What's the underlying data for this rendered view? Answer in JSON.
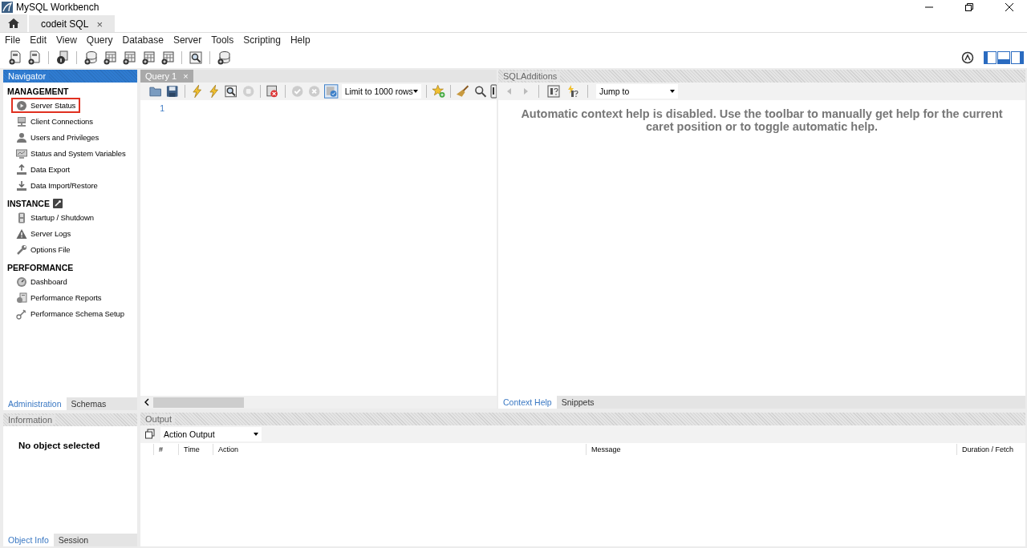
{
  "window": {
    "title": "MySQL Workbench"
  },
  "connection_tabs": [
    {
      "label": "codeit SQL",
      "close": "×",
      "selected": true
    }
  ],
  "menu": [
    "File",
    "Edit",
    "View",
    "Query",
    "Database",
    "Server",
    "Tools",
    "Scripting",
    "Help"
  ],
  "navigator": {
    "title": "Navigator",
    "sections": [
      {
        "heading": "MANAGEMENT",
        "items": [
          {
            "label": "Server Status",
            "highlighted": true
          },
          {
            "label": "Client Connections",
            "highlighted": false
          },
          {
            "label": "Users and Privileges",
            "highlighted": false
          },
          {
            "label": "Status and System Variables",
            "highlighted": false
          },
          {
            "label": "Data Export",
            "highlighted": false
          },
          {
            "label": "Data Import/Restore",
            "highlighted": false
          }
        ]
      },
      {
        "heading": "INSTANCE",
        "items": [
          {
            "label": "Startup / Shutdown",
            "highlighted": false
          },
          {
            "label": "Server Logs",
            "highlighted": false
          },
          {
            "label": "Options File",
            "highlighted": false
          }
        ]
      },
      {
        "heading": "PERFORMANCE",
        "items": [
          {
            "label": "Dashboard",
            "highlighted": false
          },
          {
            "label": "Performance Reports",
            "highlighted": false
          },
          {
            "label": "Performance Schema Setup",
            "highlighted": false
          }
        ]
      }
    ]
  },
  "navigator_tabs": [
    {
      "label": "Administration",
      "selected": true
    },
    {
      "label": "Schemas",
      "selected": false
    }
  ],
  "information": {
    "title": "Information",
    "message": "No object selected"
  },
  "info_tabs": [
    {
      "label": "Object Info",
      "selected": true
    },
    {
      "label": "Session",
      "selected": false
    }
  ],
  "query_tabs": [
    {
      "label": "Query 1",
      "close": "×"
    }
  ],
  "editor": {
    "limit": "Limit to 1000 rows",
    "line_numbers": [
      "1"
    ]
  },
  "sql_additions": {
    "title": "SQLAdditions",
    "jump_to": "Jump to",
    "help_text": "Automatic context help is disabled. Use the toolbar to manually get help for the current caret position or to toggle automatic help.",
    "tabs": [
      {
        "label": "Context Help",
        "selected": true
      },
      {
        "label": "Snippets",
        "selected": false
      }
    ]
  },
  "output": {
    "title": "Output",
    "mode": "Action Output",
    "columns": [
      "#",
      "Time",
      "Action",
      "Message",
      "Duration / Fetch"
    ]
  }
}
